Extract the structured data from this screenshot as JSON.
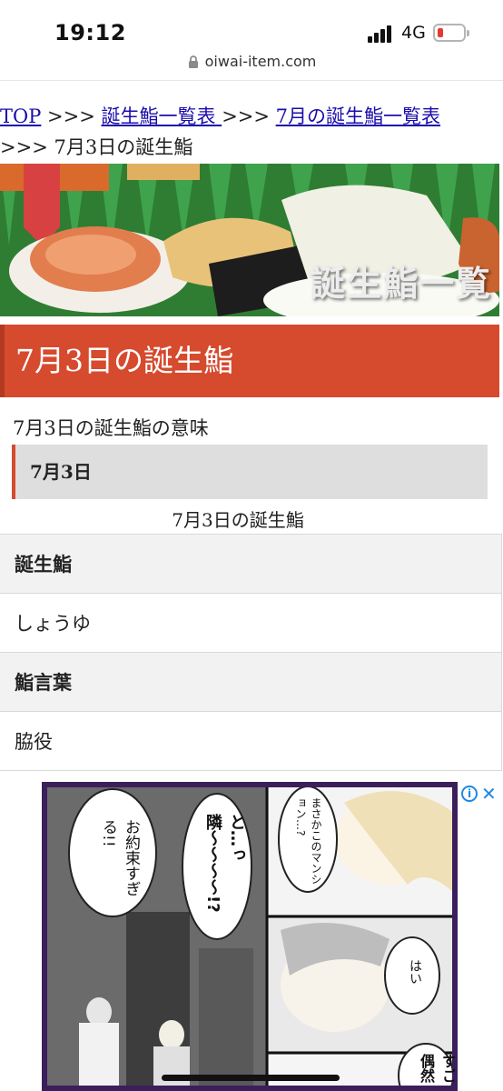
{
  "status_bar": {
    "time": "19:12",
    "network": "4G",
    "battery_level": 0.15,
    "battery_color": "#e53935"
  },
  "browser": {
    "url": "oiwai-item.com",
    "lock_icon": "lock-icon"
  },
  "breadcrumb": {
    "top": "TOP",
    "sep1": " >>> ",
    "list": "誕生鮨一覧表 ",
    "sep2": " >>> ",
    "month": "7月の誕生鮨一覧表 ",
    "sep3": ">>> ",
    "current": "7月3日の誕生鮨"
  },
  "banner": {
    "text": "誕生鮨一覧"
  },
  "page": {
    "heading": "7月3日の誕生鮨",
    "heading_color": "#d64a2e",
    "subtitle": "7月3日の誕生鮨の意味",
    "date_label": "7月3日",
    "caption": "7月3日の誕生鮨"
  },
  "table": {
    "rows": [
      {
        "label": "誕生鮨",
        "value": "しょうゆ"
      },
      {
        "label": "鮨言葉",
        "value": "脇役"
      }
    ]
  },
  "ad": {
    "bubble1": "お約束すぎる!!",
    "bubble2": "と…っ隣〜〜〜〜!?",
    "bubble3": "まさかこのマンション…?",
    "bubble4": "はい",
    "bubble5": "すご偶然",
    "info_icon": "info-icon",
    "close_icon": "close-icon"
  }
}
